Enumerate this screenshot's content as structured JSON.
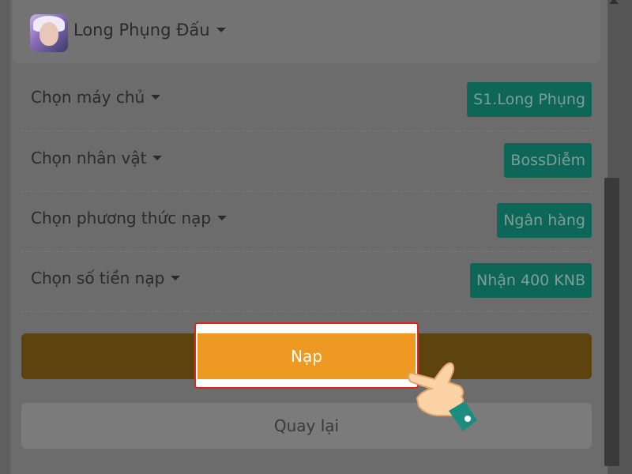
{
  "game": {
    "name": "Long Phụng Đấu",
    "avatar_icon": "character-avatar-icon",
    "dropdown_icon": "caret-down-icon"
  },
  "rows": [
    {
      "label": "Chọn máy chủ",
      "value": "S1.Long Phụng"
    },
    {
      "label": "Chọn nhân vật",
      "value": "BossDiễm"
    },
    {
      "label": "Chọn phương thức nạp",
      "value": "Ngân hàng"
    },
    {
      "label": "Chọn số tiền nạp",
      "value": "Nhận 400 KNB"
    }
  ],
  "actions": {
    "submit_label": "Nạp",
    "back_label": "Quay lại"
  },
  "colors": {
    "overlay": "#6c6c6c",
    "value_badge": "#0e6658",
    "submit": "#ee9a22",
    "highlight_border": "#e1251b"
  },
  "overlay": {
    "pointer_icon": "pointing-hand-icon"
  }
}
